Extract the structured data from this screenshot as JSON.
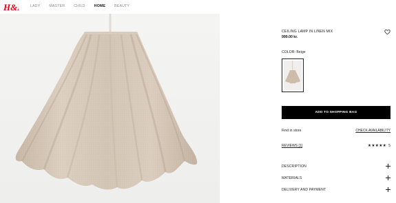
{
  "brand": {
    "logo_text": "H&M"
  },
  "nav": {
    "items": [
      {
        "label": "LADY",
        "active": false
      },
      {
        "label": "MASTER",
        "active": false
      },
      {
        "label": "CHILD",
        "active": false
      },
      {
        "label": "HOME",
        "active": true
      },
      {
        "label": "BEAUTY",
        "active": false
      }
    ]
  },
  "product": {
    "title": "CEILING LAMP IN LINEN MIX",
    "price": "999.00 kr.",
    "color_label": "COLOR: Beige",
    "add_to_bag": "ADD TO SHOPPING BAG",
    "find_in_store": "Find in store",
    "check_availability": "CHECK AVAILABILITY",
    "reviews": "REVIEWS [1]",
    "rating_stars": 5,
    "rating_value": "5"
  },
  "accordion": {
    "description": "DESCRIPTION",
    "materials": "MATERIALS",
    "delivery": "DELIVERY AND PAYMENT"
  },
  "colors": {
    "brand_red": "#e50010",
    "shade_beige": "#d2c3b3",
    "button_black": "#000000"
  },
  "icons": {
    "heart": "heart-icon",
    "plus": "plus-icon",
    "star": "star-icon"
  }
}
